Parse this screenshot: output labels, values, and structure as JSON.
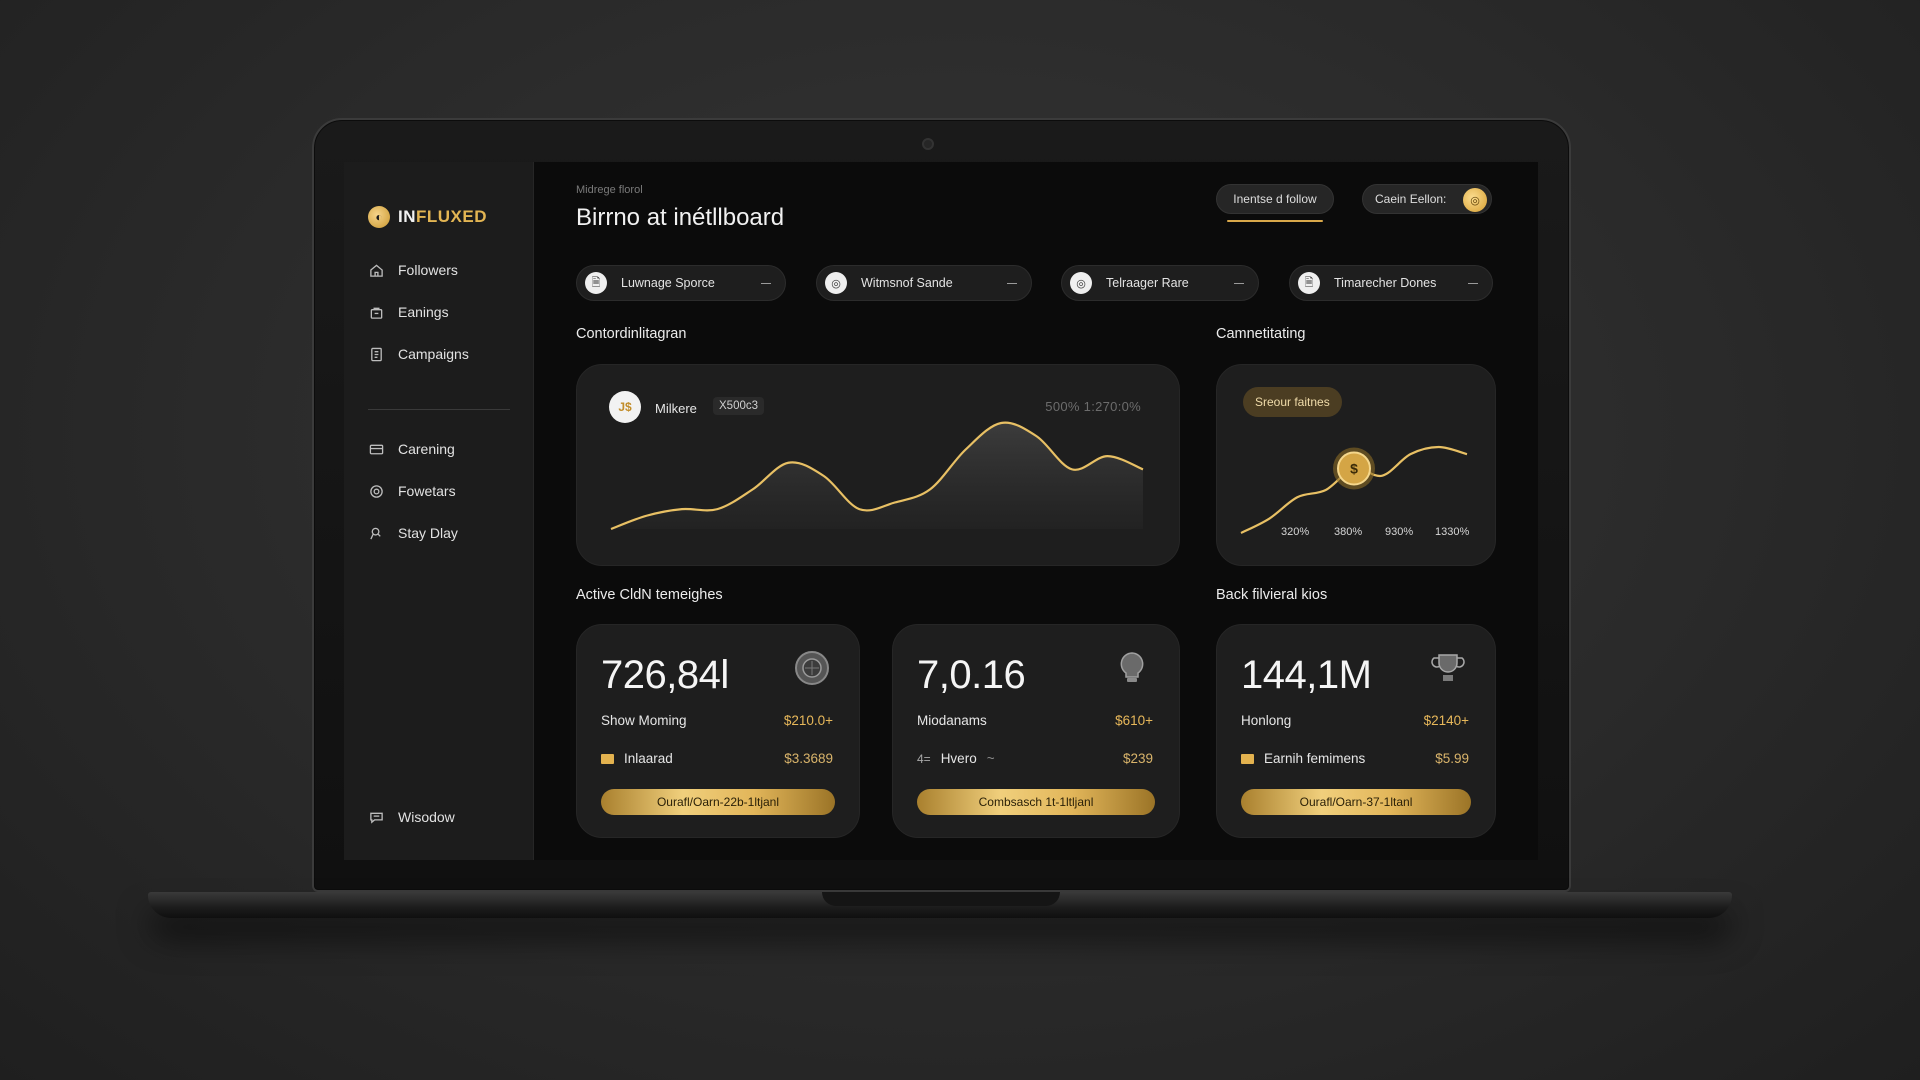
{
  "app": {
    "logo_mark": "◐",
    "logo_prefix": "IN",
    "logo_suffix": "FLUXED"
  },
  "sidebar": {
    "items": [
      {
        "label": "Followers",
        "icon": "home-icon"
      },
      {
        "label": "Eanings",
        "icon": "bag-icon"
      },
      {
        "label": "Campaigns",
        "icon": "document-icon"
      }
    ],
    "items2": [
      {
        "label": "Carening",
        "icon": "card-icon"
      },
      {
        "label": "Fowetars",
        "icon": "target-icon"
      },
      {
        "label": "Stay Dlay",
        "icon": "pin-icon"
      }
    ],
    "footer_item": {
      "label": "Wisodow",
      "icon": "chat-icon"
    }
  },
  "header": {
    "breadcrumb": "Midrege florol",
    "title": "Birrno at inétllboard",
    "follow_button": "Inentse d follow",
    "cash_button": "Caein Eellon:",
    "cash_coin": "◎"
  },
  "filters": [
    {
      "label": "Luwnage Sporce",
      "icon": "🗎"
    },
    {
      "label": "Witmsnof Sande",
      "icon": "◎"
    },
    {
      "label": "Telraager Rare",
      "icon": "◎"
    },
    {
      "label": "Timarecher Dones",
      "icon": "🗎"
    }
  ],
  "sections": {
    "left_chart_title": "Contordinlitagran",
    "right_chart_title": "Camnetitating",
    "stats_title": "Active CldN temeighes",
    "back_title": "Back filvieral kios"
  },
  "main_chart": {
    "coin_label": "J$",
    "series_name": "Milkere",
    "badge": "X500c3",
    "range": "500% 1:270:0%"
  },
  "side_chart": {
    "badge": "Sreour faitnes",
    "coin": "$",
    "ticks": [
      "320%",
      "380%",
      "930%",
      "1330%"
    ]
  },
  "chart_data": [
    {
      "type": "area",
      "series": [
        {
          "name": "Milkere",
          "values": [
            0,
            2,
            3,
            3,
            6,
            10,
            8,
            3,
            4,
            6,
            12,
            16,
            14,
            9,
            11,
            9
          ]
        }
      ],
      "color": "#e8c064"
    },
    {
      "type": "line",
      "categories": [
        "320%",
        "380%",
        "930%",
        "1330%"
      ],
      "series": [
        {
          "values": [
            0,
            2,
            5,
            6,
            9,
            8,
            11,
            12,
            11
          ]
        }
      ],
      "color": "#e8c064"
    }
  ],
  "cards": [
    {
      "value": "726,84l",
      "icon": "globe-icon",
      "row1_label": "Show Moming",
      "row1_value": "$210.0+",
      "row2_label": "Inlaarad",
      "row2_value": "$3.3689",
      "row2_icon": "flag-icon",
      "cta": "Ourafl/Oarn-22b-1ltjanl"
    },
    {
      "value": "7,0.16",
      "icon": "bulb-icon",
      "row1_label": "Miodanams",
      "row1_value": "$610+",
      "row2_label": "Hvero",
      "row2_prefix": "4=",
      "row2_suffix": "~",
      "row2_value": "$239",
      "cta": "Combsasch 1t-1ltljanl"
    },
    {
      "value": "144,1M",
      "icon": "trophy-icon",
      "row1_label": "Honlong",
      "row1_value": "$2140+",
      "row2_label": "Earnih femimens",
      "row2_value": "$5.99",
      "row2_icon": "flag-icon",
      "cta": "Ourafl/Oarn-37-1ltanl"
    }
  ],
  "colors": {
    "accent": "#e3b553",
    "background": "#0b0b0b",
    "panel": "#1e1e1e"
  }
}
